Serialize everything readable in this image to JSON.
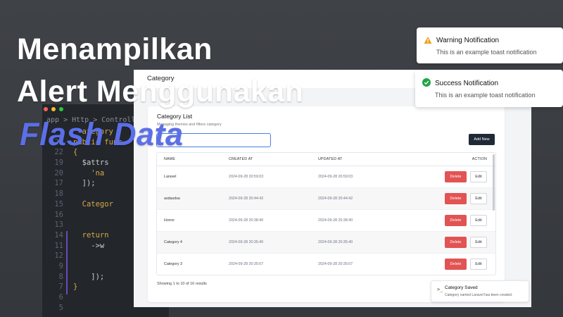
{
  "title": {
    "line1": "Menampilkan",
    "line2": "Alert Menggunakan",
    "line3": "Flash Data"
  },
  "editor": {
    "breadcrumb": "app > Http > Controllers >",
    "dot_colors": [
      "#ff5f57",
      "#febc2e",
      "#28c840"
    ],
    "lines": [
      {
        "num": "",
        "text": "  ategory",
        "style": "y"
      },
      {
        "num": "21",
        "text": "public func",
        "style": "y"
      },
      {
        "num": "22",
        "text": "{",
        "style": "y"
      },
      {
        "num": "19",
        "text": "  $attrs",
        "style": "w"
      },
      {
        "num": "20",
        "text": "    'na",
        "style": "y"
      },
      {
        "num": "17",
        "text": "  ]);",
        "style": "w"
      },
      {
        "num": "18",
        "text": "",
        "style": "w"
      },
      {
        "num": "15",
        "text": "  Categor",
        "style": "y"
      },
      {
        "num": "16",
        "text": "",
        "style": "w"
      },
      {
        "num": "13",
        "text": "",
        "style": "w"
      },
      {
        "num": "14",
        "text": "  return",
        "style": "y"
      },
      {
        "num": "11",
        "text": "    ->w",
        "style": "w"
      },
      {
        "num": "12",
        "text": "",
        "style": "w"
      },
      {
        "num": "9",
        "text": "",
        "style": "w"
      },
      {
        "num": "8",
        "text": "    ]);",
        "style": "w"
      },
      {
        "num": "7",
        "text": "}",
        "style": "y"
      },
      {
        "num": "6",
        "text": "",
        "style": "w"
      },
      {
        "num": "5",
        "text": "",
        "style": "w"
      }
    ]
  },
  "app": {
    "header_title": "Category",
    "card_title": "Category List",
    "card_subtitle": "Managing themes and filters category",
    "search_placeholder": "",
    "add_button": "Add New",
    "table": {
      "headers": [
        "NAME",
        "CREATED AT",
        "UPDATED AT",
        "ACTION"
      ],
      "rows": [
        {
          "name": "Laravel",
          "created": "2024-09-28 20:59:03",
          "updated": "2024-09-28 20:59:03"
        },
        {
          "name": "asdasdsa",
          "created": "2024-09-28 20:44:42",
          "updated": "2024-09-28 20:44:42"
        },
        {
          "name": "Horror",
          "created": "2024-09-28 20:38:40",
          "updated": "2024-09-28 20:38:40"
        },
        {
          "name": "Category 4",
          "created": "2024-09-28 20:35:40",
          "updated": "2024-09-28 20:35:40"
        },
        {
          "name": "Category 3",
          "created": "2024-09-28 20:35:07",
          "updated": "2024-09-28 20:35:07"
        }
      ],
      "delete_label": "Delete",
      "edit_label": "Edit"
    },
    "showing_text": "Showing 1 to 10 of 16 results"
  },
  "toasts": {
    "warning": {
      "title": "Warning Notification",
      "message": "This is an example toast notification",
      "color": "#f0a020"
    },
    "success": {
      "title": "Success Notification",
      "message": "This is an example toast notification",
      "color": "#22a447"
    },
    "saved": {
      "icon": ">_",
      "title": "Category Saved",
      "message": "Category named Laravel has been created."
    }
  },
  "colors": {
    "accent_title": "#5b6fe8",
    "delete": "#e25353",
    "primary_dark": "#1f2937"
  }
}
